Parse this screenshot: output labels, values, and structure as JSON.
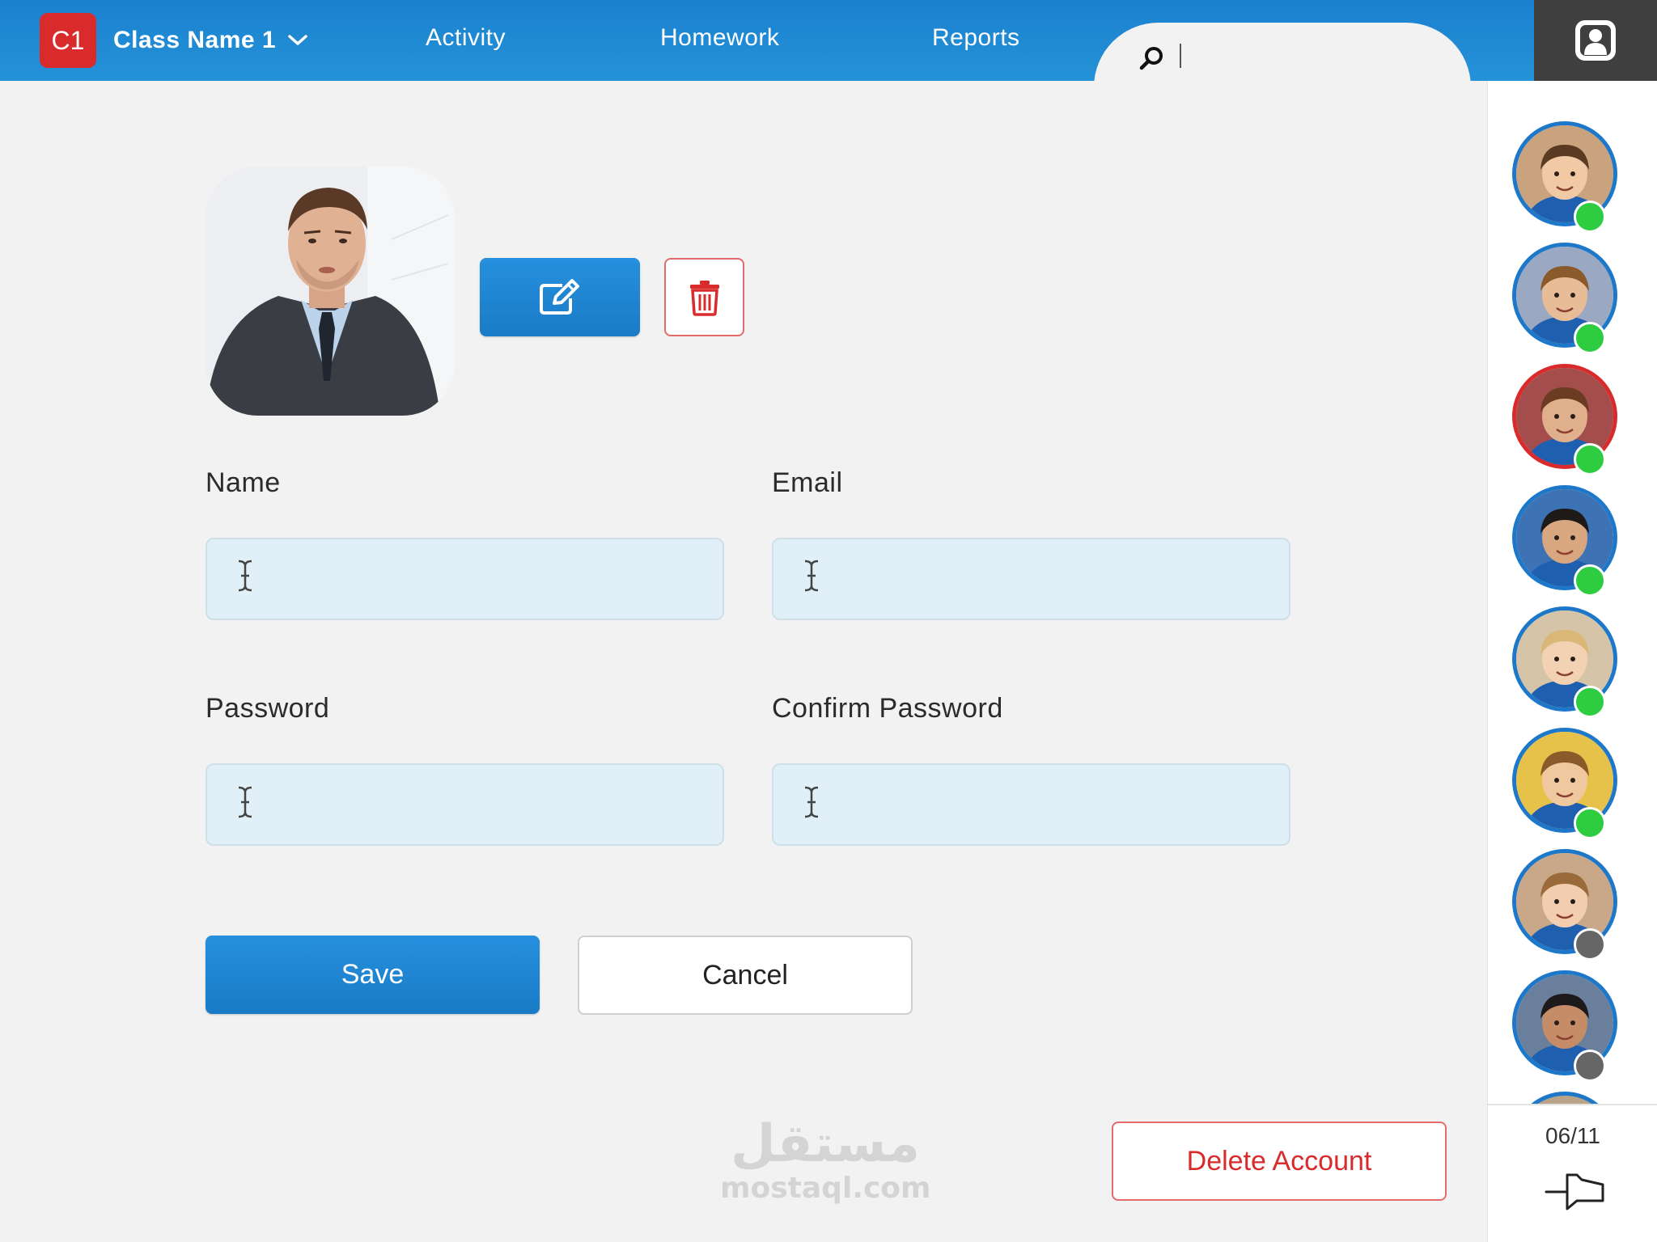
{
  "header": {
    "class_badge": "C1",
    "class_name": "Class Name 1",
    "nav": [
      "Activity",
      "Homework",
      "Reports"
    ],
    "search_value": ""
  },
  "profile": {
    "edit_photo_icon": "edit-icon",
    "delete_photo_icon": "trash-icon"
  },
  "form": {
    "name_label": "Name",
    "name_value": "",
    "email_label": "Email",
    "email_value": "",
    "password_label": "Password",
    "password_value": "",
    "confirm_label": "Confirm Password",
    "confirm_value": ""
  },
  "actions": {
    "save": "Save",
    "cancel": "Cancel",
    "delete_account": "Delete Account"
  },
  "sidebar": {
    "students": [
      {
        "status": "online"
      },
      {
        "status": "online"
      },
      {
        "status": "online",
        "alert": true
      },
      {
        "status": "online"
      },
      {
        "status": "online"
      },
      {
        "status": "online"
      },
      {
        "status": "offline"
      },
      {
        "status": "offline"
      }
    ],
    "page_counter": "06/11"
  },
  "watermark": {
    "arabic": "مستقل",
    "latin": "mostaql.com"
  },
  "colors": {
    "accent_blue": "#1d78c9",
    "danger_red": "#d92b2b",
    "online": "#2ecc40",
    "offline": "#666666"
  }
}
